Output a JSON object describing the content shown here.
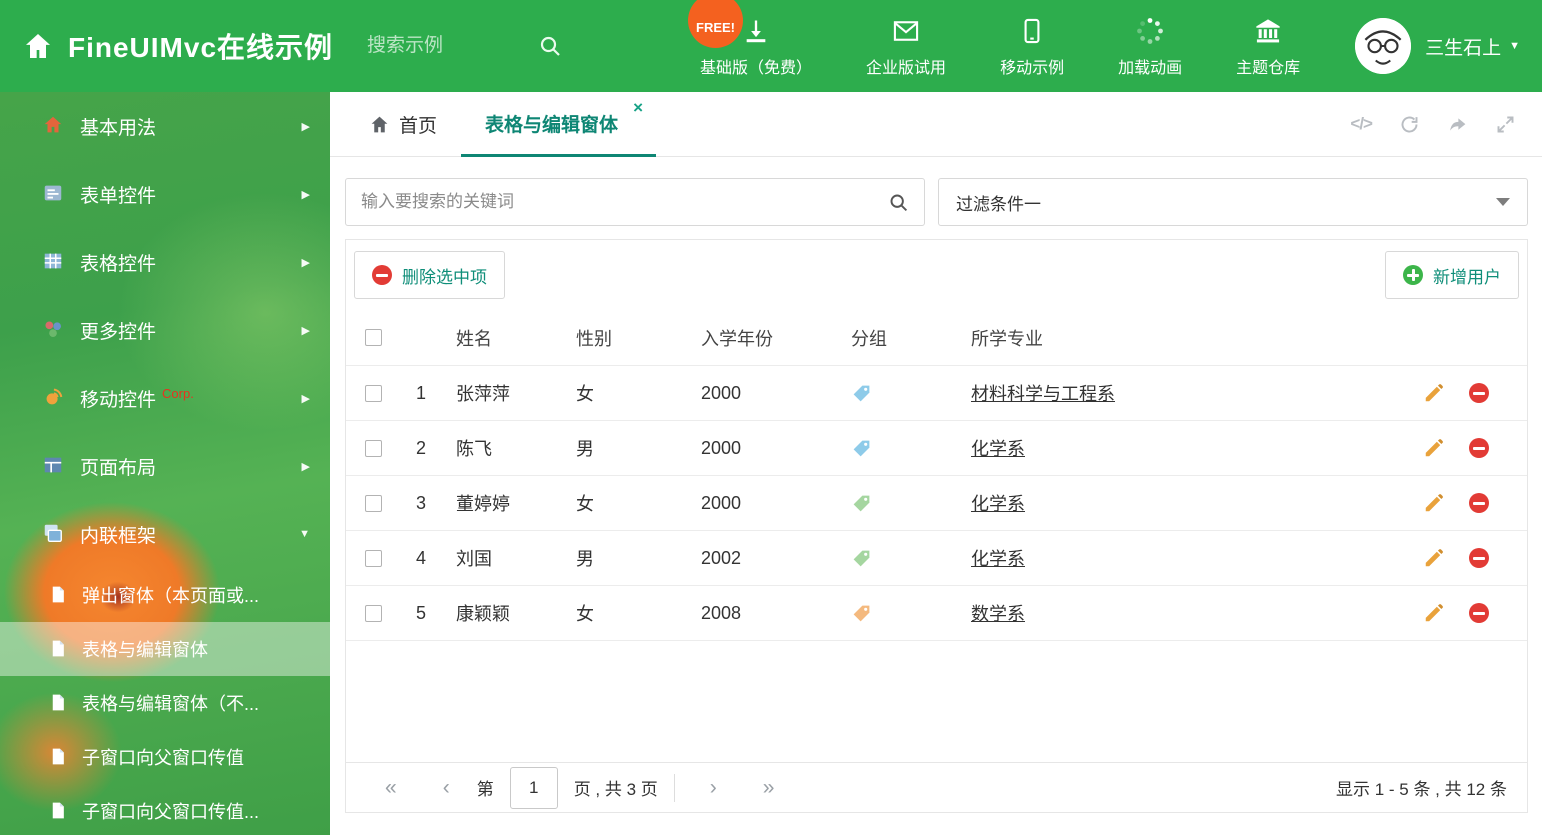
{
  "colors": {
    "header_green": "#2dad4d",
    "accent_teal": "#0e8674",
    "free_badge_orange": "#f4611f",
    "delete_red": "#e23b35",
    "add_green": "#3cb54a",
    "edit_pencil_orange": "#e9a23b",
    "tag_blue": "#8ecbe9",
    "tag_green": "#a5d6a0",
    "tag_orange": "#f4b97e"
  },
  "icons": {
    "chevron_right": "▶",
    "chevron_down": "▼",
    "caret_down": "▼",
    "close": "×",
    "code": "</>",
    "first": "«",
    "prev": "‹",
    "next": "›",
    "last": "»"
  },
  "header": {
    "title": "FineUIMvc在线示例",
    "search_placeholder": "搜索示例",
    "free_badge": "FREE!",
    "nav": [
      {
        "label": "基础版（免费）",
        "icon": "download-icon"
      },
      {
        "label": "企业版试用",
        "icon": "mail-icon"
      },
      {
        "label": "移动示例",
        "icon": "mobile-icon"
      },
      {
        "label": "加载动画",
        "icon": "loading-icon"
      },
      {
        "label": "主题仓库",
        "icon": "bank-icon"
      }
    ],
    "user_name": "三生石上"
  },
  "sidebar": {
    "items": [
      {
        "label": "基本用法",
        "icon": "home-icon"
      },
      {
        "label": "表单控件",
        "icon": "form-icon"
      },
      {
        "label": "表格控件",
        "icon": "table-icon"
      },
      {
        "label": "更多控件",
        "icon": "blocks-icon"
      },
      {
        "label": "移动控件",
        "icon": "mobile-icon",
        "badge": "Corp."
      },
      {
        "label": "页面布局",
        "icon": "layout-icon"
      },
      {
        "label": "内联框架",
        "icon": "frame-icon",
        "expanded": true
      }
    ],
    "submenu": [
      {
        "label": "弹出窗体（本页面或..."
      },
      {
        "label": "表格与编辑窗体",
        "active": true
      },
      {
        "label": "表格与编辑窗体（不..."
      },
      {
        "label": "子窗口向父窗口传值"
      },
      {
        "label": "子窗口向父窗口传值..."
      }
    ]
  },
  "tabs": {
    "home_label": "首页",
    "active_label": "表格与编辑窗体"
  },
  "filter_bar": {
    "search_placeholder": "输入要搜索的关键词",
    "filter_selected": "过滤条件一"
  },
  "toolbar": {
    "delete_label": "删除选中项",
    "add_label": "新增用户"
  },
  "table": {
    "headers": {
      "name": "姓名",
      "gender": "性别",
      "year": "入学年份",
      "group": "分组",
      "major": "所学专业"
    },
    "rows": [
      {
        "index": "1",
        "name": "张萍萍",
        "gender": "女",
        "year": "2000",
        "tag_color": "#8ecbe9",
        "major": "材料科学与工程系"
      },
      {
        "index": "2",
        "name": "陈飞",
        "gender": "男",
        "year": "2000",
        "tag_color": "#8ecbe9",
        "major": "化学系"
      },
      {
        "index": "3",
        "name": "董婷婷",
        "gender": "女",
        "year": "2000",
        "tag_color": "#a5d6a0",
        "major": "化学系"
      },
      {
        "index": "4",
        "name": "刘国",
        "gender": "男",
        "year": "2002",
        "tag_color": "#a5d6a0",
        "major": "化学系"
      },
      {
        "index": "5",
        "name": "康颖颖",
        "gender": "女",
        "year": "2008",
        "tag_color": "#f4b97e",
        "major": "数学系"
      }
    ]
  },
  "pagination": {
    "page_label_prefix": "第",
    "current_page": "1",
    "page_label_suffix": "页 , 共 3 页",
    "summary": "显示 1 - 5 条 , 共 12 条"
  }
}
